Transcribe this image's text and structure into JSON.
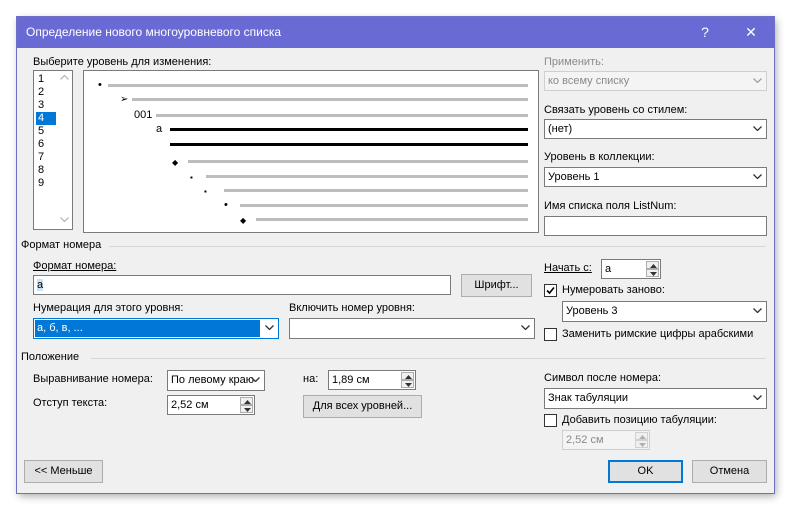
{
  "dialog": {
    "title": "Определение нового многоуровневого списка",
    "help_label": "?",
    "close_label": "✕"
  },
  "level_select": {
    "label": "Выберите уровень для изменения:",
    "levels": [
      "1",
      "2",
      "3",
      "4",
      "5",
      "6",
      "7",
      "8",
      "9"
    ],
    "selected": "4"
  },
  "preview": {
    "markers": [
      "•",
      "➢",
      "001",
      "a",
      "◆",
      "▪",
      "▪",
      "•",
      "◆"
    ]
  },
  "right_panel": {
    "apply_label": "Применить:",
    "apply_value": "ко всему списку",
    "link_style_label": "Связать уровень со стилем:",
    "link_style_value": "(нет)",
    "gallery_level_label": "Уровень в коллекции:",
    "gallery_level_value": "Уровень 1",
    "listnum_label": "Имя списка поля ListNum:",
    "listnum_value": ""
  },
  "number_format": {
    "section_label": "Формат номера",
    "format_label": "Формат номера:",
    "format_value": "a",
    "font_button": "Шрифт...",
    "numbering_label": "Нумерация для этого уровня:",
    "numbering_value": "a, б, в, ...",
    "include_label": "Включить номер уровня:",
    "include_value": "",
    "start_label": "Начать с:",
    "start_value": "a",
    "restart_label": "Нумеровать заново:",
    "restart_checked": true,
    "restart_value": "Уровень 3",
    "legal_label": "Заменить римские цифры арабскими",
    "legal_checked": false
  },
  "position": {
    "section_label": "Положение",
    "align_label": "Выравнивание номера:",
    "align_value": "По левому краю",
    "at_label": "на:",
    "at_value": "1,89 см",
    "indent_label": "Отступ текста:",
    "indent_value": "2,52 см",
    "all_levels_button": "Для всех уровней...",
    "follow_label": "Символ после номера:",
    "follow_value": "Знак табуляции",
    "add_tab_label": "Добавить позицию табуляции:",
    "add_tab_checked": false,
    "add_tab_value": "2,52 см"
  },
  "footer": {
    "less_button": "<< Меньше",
    "ok_button": "OK",
    "cancel_button": "Отмена"
  },
  "colors": {
    "titlebar": "#6a6ad4",
    "selection": "#0078d7",
    "dialog_bg": "#f0f0f0"
  }
}
